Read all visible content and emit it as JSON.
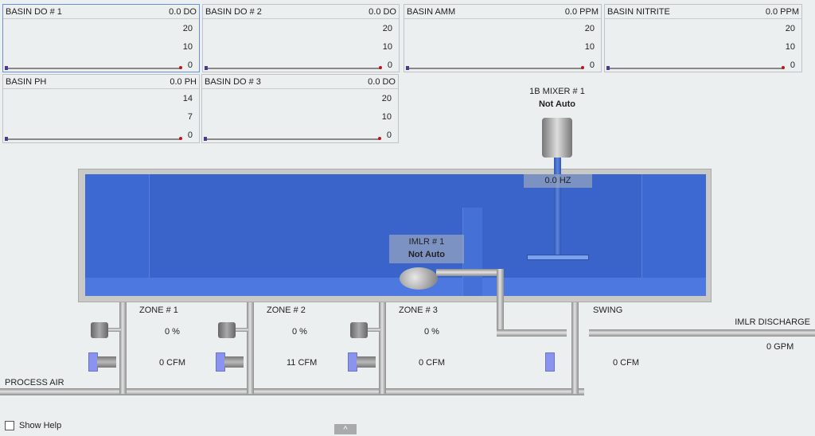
{
  "panels": [
    {
      "title": "BASIN DO # 1",
      "value": "0.0 DO",
      "ticks": [
        "20",
        "10",
        "0"
      ]
    },
    {
      "title": "BASIN DO # 2",
      "value": "0.0 DO",
      "ticks": [
        "20",
        "10",
        "0"
      ]
    },
    {
      "title": "BASIN AMM",
      "value": "0.0 PPM",
      "ticks": [
        "20",
        "10",
        "0"
      ]
    },
    {
      "title": "BASIN NITRITE",
      "value": "0.0 PPM",
      "ticks": [
        "20",
        "10",
        "0"
      ]
    },
    {
      "title": "BASIN PH",
      "value": "0.0 PH",
      "ticks": [
        "14",
        "7",
        "0"
      ]
    },
    {
      "title": "BASIN DO # 3",
      "value": "0.0 DO",
      "ticks": [
        "20",
        "10",
        "0"
      ]
    }
  ],
  "mixer": {
    "title": "1B MIXER # 1",
    "status": "Not Auto",
    "speed": "0.0 HZ"
  },
  "imlr": {
    "title": "IMLR # 1",
    "status": "Not Auto"
  },
  "zones": [
    {
      "name": "ZONE # 1",
      "pct": "0 %",
      "flow": "0 CFM"
    },
    {
      "name": "ZONE # 2",
      "pct": "0 %",
      "flow": "11 CFM"
    },
    {
      "name": "ZONE # 3",
      "pct": "0 %",
      "flow": "0 CFM"
    }
  ],
  "swing": {
    "name": "SWING",
    "flow": "0 CFM"
  },
  "discharge": {
    "name": "IMLR DISCHARGE",
    "flow": "0 GPM"
  },
  "process_air": "PROCESS AIR",
  "show_help": "Show Help",
  "collapse": "^"
}
